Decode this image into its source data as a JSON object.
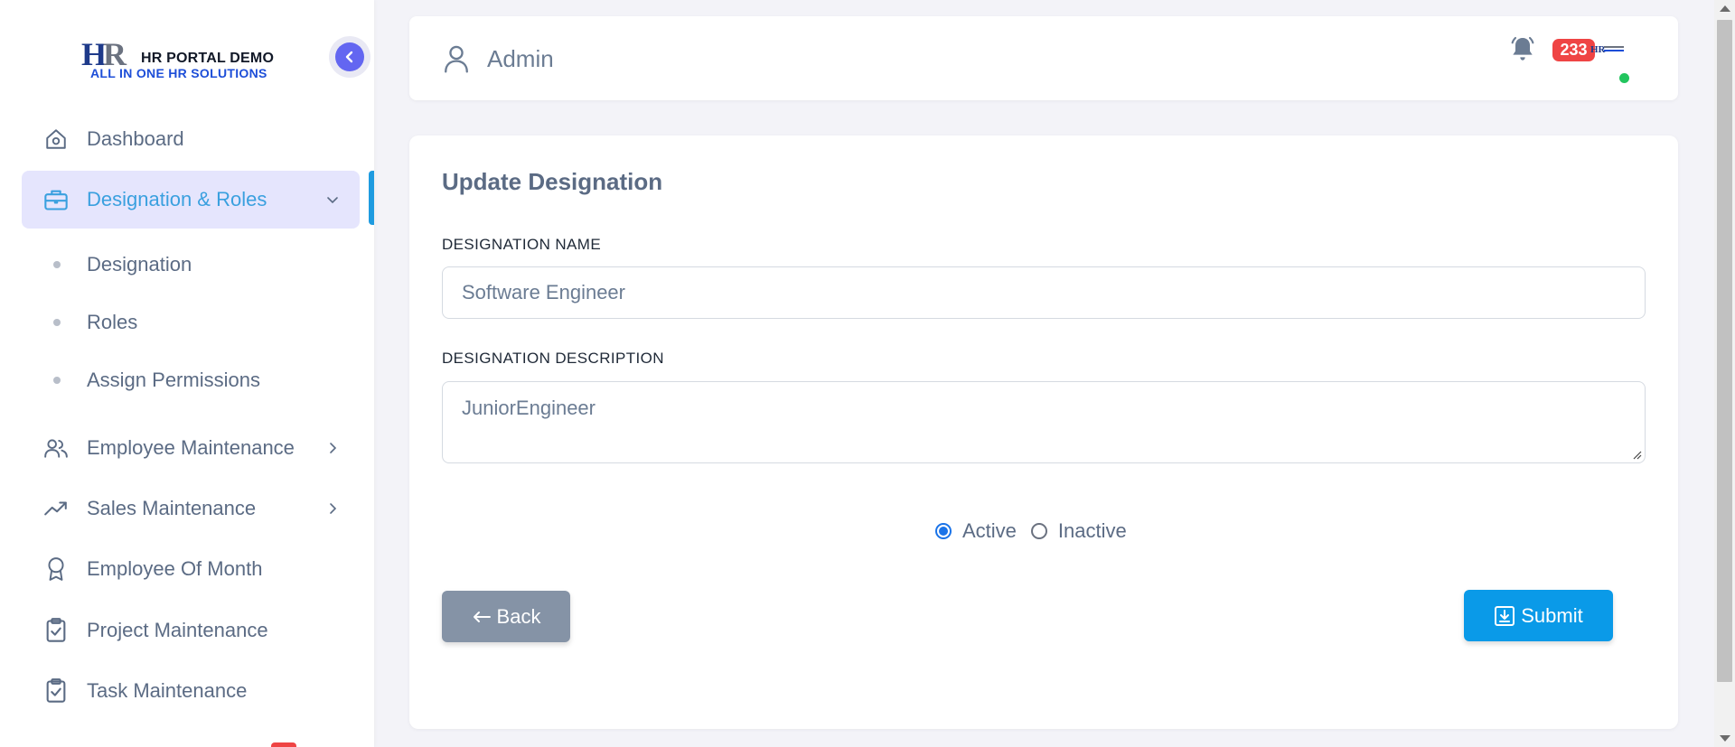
{
  "brand": {
    "logo_mark": "HR",
    "title": "HR PORTAL DEMO",
    "subtitle": "ALL IN ONE HR SOLUTIONS"
  },
  "sidebar": {
    "items": [
      {
        "label": "Dashboard",
        "icon": "home-icon"
      },
      {
        "label": "Designation & Roles",
        "icon": "briefcase-icon",
        "active": true,
        "expanded": true
      },
      {
        "label": "Employee Maintenance",
        "icon": "users-icon"
      },
      {
        "label": "Sales Maintenance",
        "icon": "trending-up-icon"
      },
      {
        "label": "Employee Of Month",
        "icon": "award-icon"
      },
      {
        "label": "Project Maintenance",
        "icon": "clipboard-check-icon"
      },
      {
        "label": "Task Maintenance",
        "icon": "clipboard-check-icon"
      }
    ],
    "sub_items": [
      {
        "label": "Designation"
      },
      {
        "label": "Roles"
      },
      {
        "label": "Assign Permissions"
      }
    ]
  },
  "header": {
    "user_name": "Admin",
    "notification_count": "233",
    "status": "online"
  },
  "form": {
    "title": "Update Designation",
    "name_label": "DESIGNATION NAME",
    "name_value": "Software Engineer",
    "description_label": "DESIGNATION DESCRIPTION",
    "description_value": "JuniorEngineer",
    "status_options": [
      {
        "label": "Active",
        "checked": true
      },
      {
        "label": "Inactive",
        "checked": false
      }
    ],
    "back_label": "Back",
    "submit_label": "Submit"
  },
  "colors": {
    "accent": "#6366f1",
    "active_text": "#3aa0df",
    "active_bg": "#e5e5fd",
    "submit": "#0a9ae8",
    "back": "#8593a6",
    "badge": "#ef4444",
    "online": "#22c55e"
  }
}
